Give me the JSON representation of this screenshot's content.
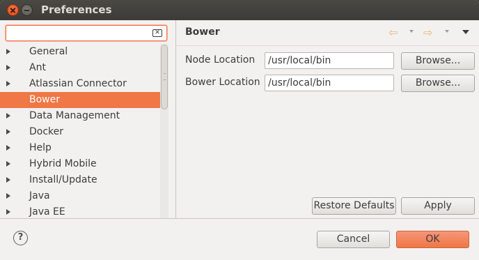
{
  "window": {
    "title": "Preferences"
  },
  "filter": {
    "value": "",
    "placeholder": ""
  },
  "tree": {
    "items": [
      {
        "label": "General",
        "selected": false
      },
      {
        "label": "Ant",
        "selected": false
      },
      {
        "label": "Atlassian Connector",
        "selected": false
      },
      {
        "label": "Bower",
        "selected": true
      },
      {
        "label": "Data Management",
        "selected": false
      },
      {
        "label": "Docker",
        "selected": false
      },
      {
        "label": "Help",
        "selected": false
      },
      {
        "label": "Hybrid Mobile",
        "selected": false
      },
      {
        "label": "Install/Update",
        "selected": false
      },
      {
        "label": "Java",
        "selected": false
      },
      {
        "label": "Java EE",
        "selected": false
      }
    ]
  },
  "page": {
    "title": "Bower",
    "back_icon": "⇦",
    "forward_icon": "⇨"
  },
  "fields": {
    "node_label": "Node Location",
    "node_value": "/usr/local/bin",
    "bower_label": "Bower Location",
    "bower_value": "/usr/local/bin",
    "browse_label": "Browse..."
  },
  "buttons": {
    "restore_defaults": "Restore Defaults",
    "apply": "Apply",
    "cancel": "Cancel",
    "ok": "OK",
    "help": "?"
  },
  "colors": {
    "accent": "#f07746",
    "titlebar": "#3c3b37",
    "background": "#f2f1f0"
  }
}
